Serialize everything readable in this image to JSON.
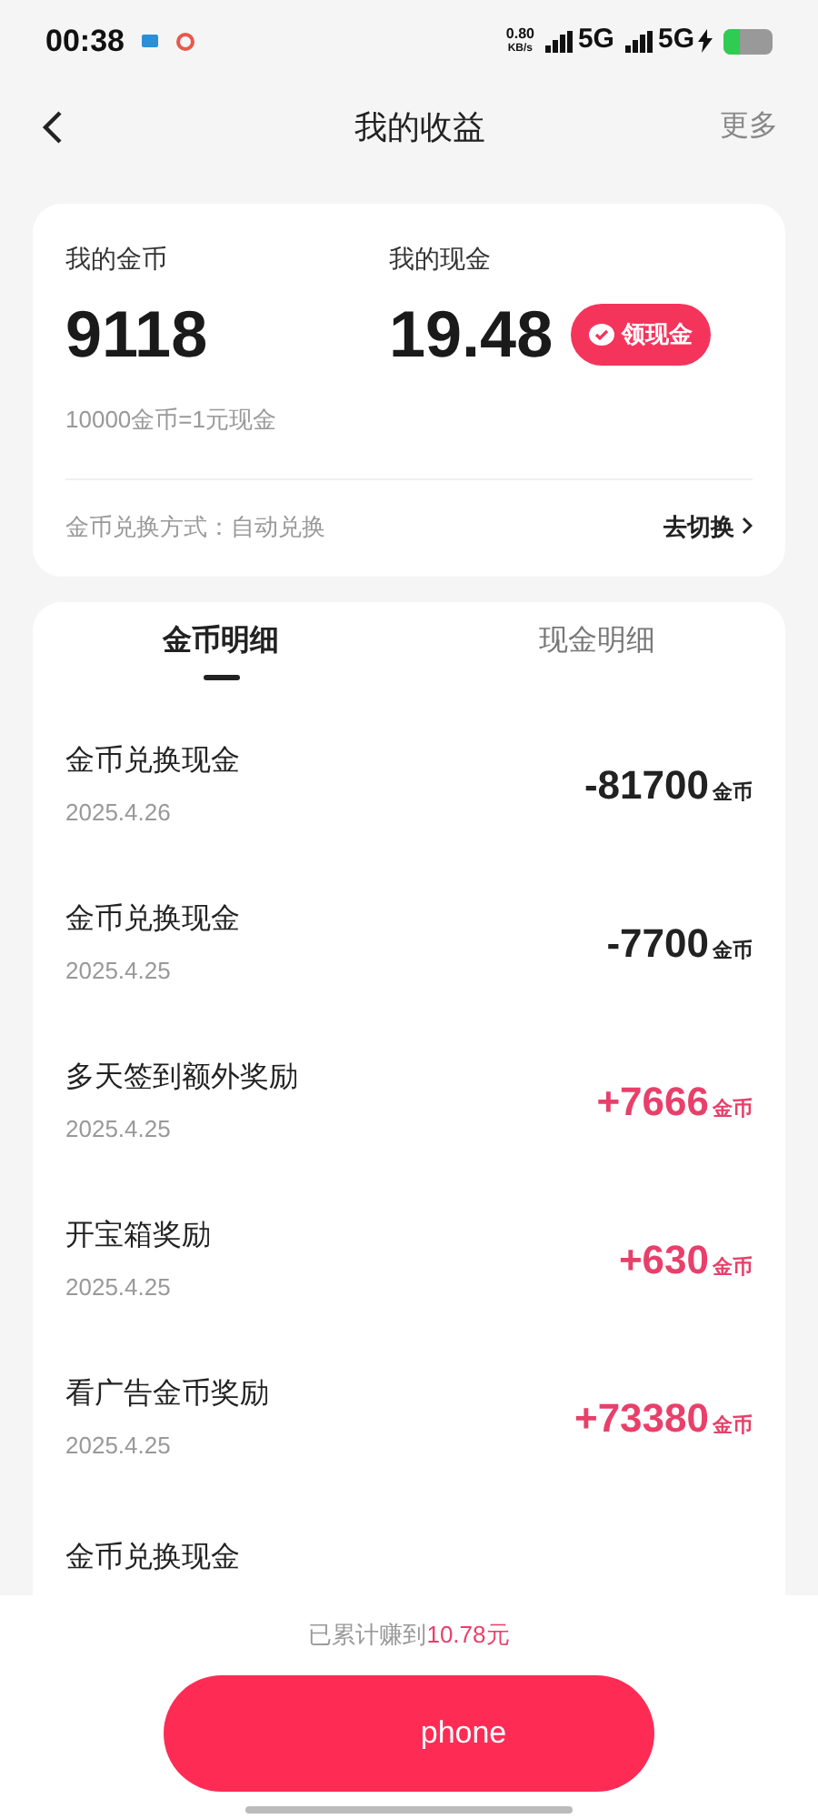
{
  "status_bar": {
    "time": "00:38",
    "speed": "0.80",
    "speed_unit": "KB/s",
    "network_1": "5G",
    "network_2": "5G"
  },
  "header": {
    "title": "我的收益",
    "more": "更多"
  },
  "summary": {
    "coins_label": "我的金币",
    "coins": "9118",
    "cash_label": "我的现金",
    "cash": "19.48",
    "withdraw_button": "领现金",
    "rate": "10000金币=1元现金",
    "exchange_mode": "金币兑换方式：自动兑换",
    "switch_link": "去切换"
  },
  "tabs": [
    {
      "label": "金币明细",
      "selected": true
    },
    {
      "label": "现金明细",
      "selected": false
    }
  ],
  "records": [
    {
      "title": "金币兑换现金",
      "date": "2025.4.26",
      "amount": "-81700",
      "unit": "金币",
      "kind": "expense"
    },
    {
      "title": "金币兑换现金",
      "date": "2025.4.25",
      "amount": "-7700",
      "unit": "金币",
      "kind": "expense"
    },
    {
      "title": "多天签到额外奖励",
      "date": "2025.4.25",
      "amount": "+7666",
      "unit": "金币",
      "kind": "income"
    },
    {
      "title": "开宝箱奖励",
      "date": "2025.4.25",
      "amount": "+630",
      "unit": "金币",
      "kind": "income"
    },
    {
      "title": "看广告金币奖励",
      "date": "2025.4.25",
      "amount": "+73380",
      "unit": "金币",
      "kind": "income"
    }
  ],
  "cut_bottom_title": "金币兑换现金",
  "bottom_bar": {
    "earned_label": "已累计赚到",
    "earned_value": "10.78元",
    "action_button": "phone"
  }
}
